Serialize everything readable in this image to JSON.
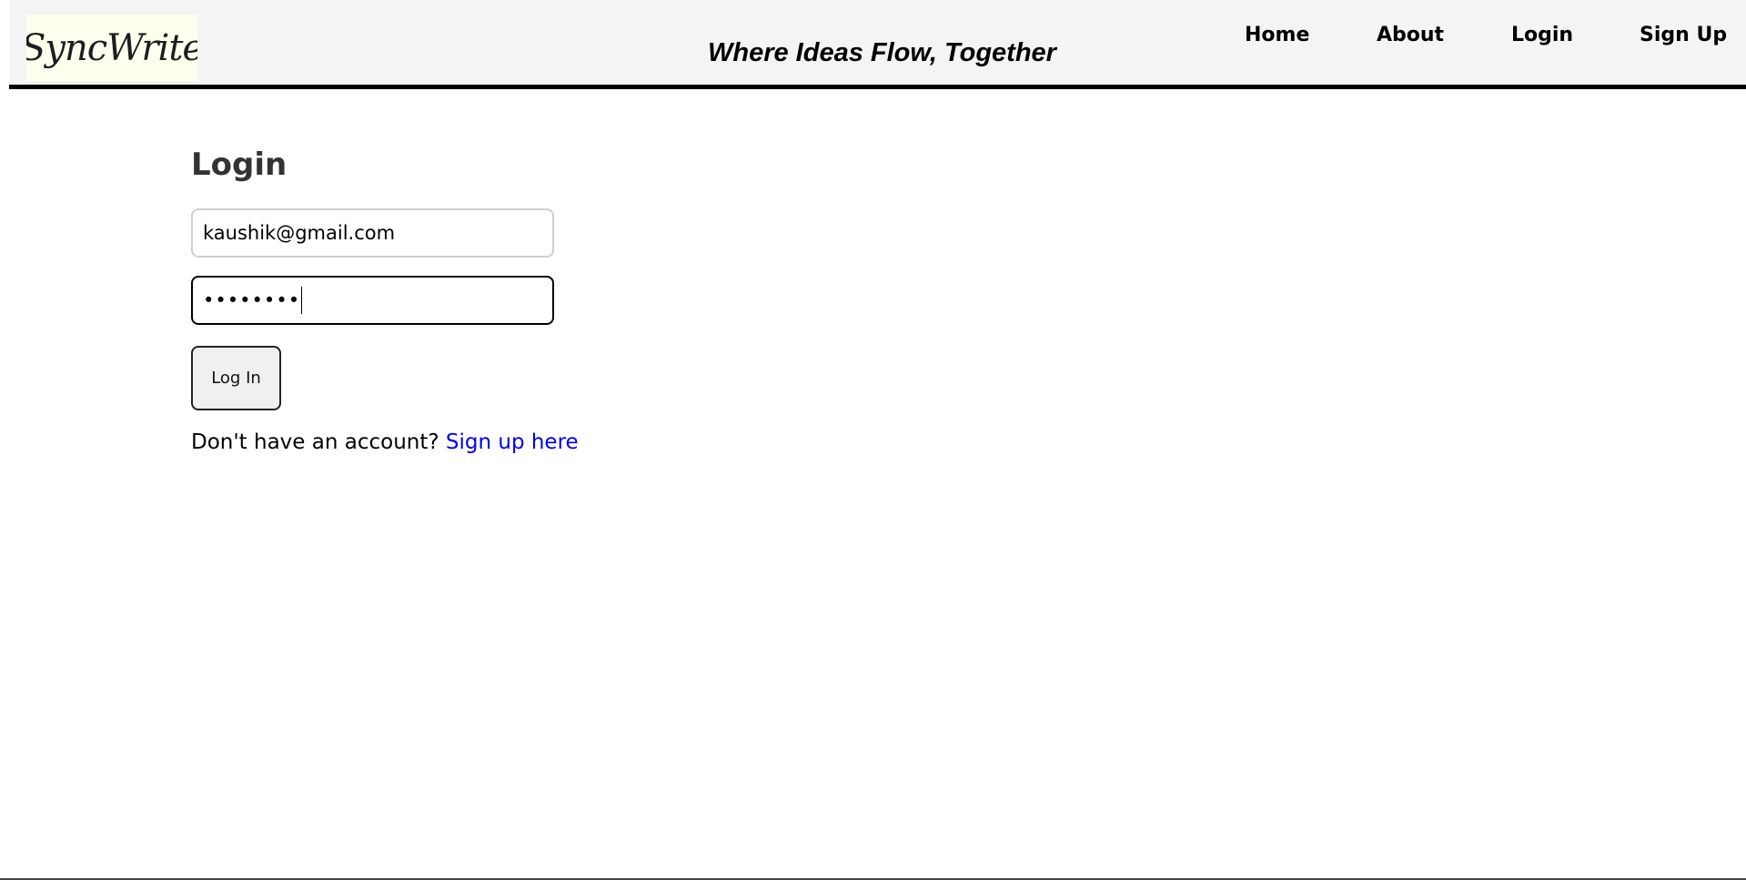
{
  "header": {
    "logo_text": "SyncWrite",
    "tagline": "Where Ideas Flow, Together",
    "nav": [
      {
        "label": "Home"
      },
      {
        "label": "About"
      },
      {
        "label": "Login"
      },
      {
        "label": "Sign Up"
      }
    ]
  },
  "login": {
    "title": "Login",
    "email_value": "kaushik@gmail.com",
    "password_mask": "••••••••",
    "submit_label": "Log In",
    "signup_prompt": "Don't have an account?",
    "signup_link": "Sign up here"
  },
  "colors": {
    "header_bg": "#f4f4f4",
    "link": "#0000ee",
    "title": "#333333"
  }
}
